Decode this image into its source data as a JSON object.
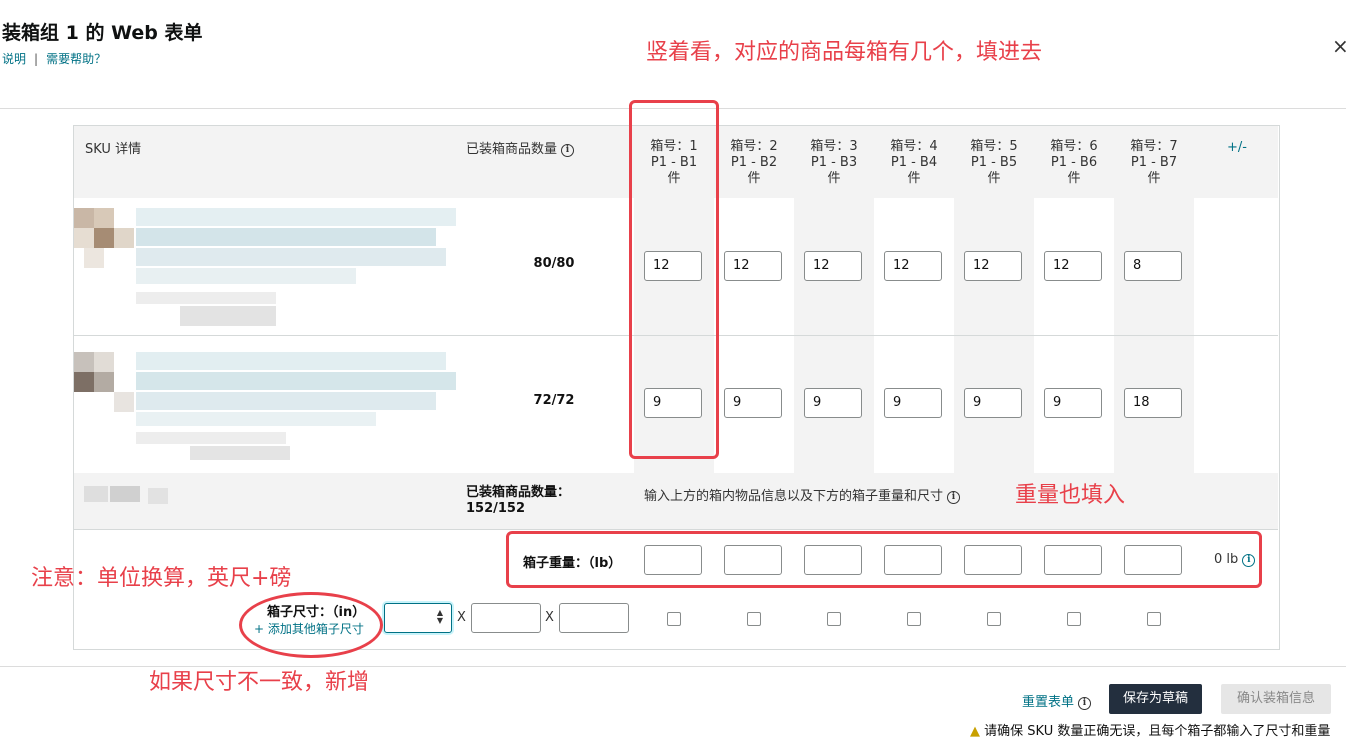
{
  "dialog": {
    "title": "装箱组 1 的 Web 表单",
    "link_instructions": "说明",
    "link_separator": "|",
    "link_help": "需要帮助？",
    "close_glyph": "×"
  },
  "table": {
    "col_sku": "SKU 详情",
    "col_packed": "已装箱商品数量",
    "add_remove": "+/-",
    "boxes": [
      {
        "line1": "箱号：1",
        "line2": "P1 - B1",
        "line3": "件"
      },
      {
        "line1": "箱号：2",
        "line2": "P1 - B2",
        "line3": "件"
      },
      {
        "line1": "箱号：3",
        "line2": "P1 - B3",
        "line3": "件"
      },
      {
        "line1": "箱号：4",
        "line2": "P1 - B4",
        "line3": "件"
      },
      {
        "line1": "箱号：5",
        "line2": "P1 - B5",
        "line3": "件"
      },
      {
        "line1": "箱号：6",
        "line2": "P1 - B6",
        "line3": "件"
      },
      {
        "line1": "箱号：7",
        "line2": "P1 - B7",
        "line3": "件"
      }
    ],
    "rows": [
      {
        "packed": "80/80",
        "values": [
          "12",
          "12",
          "12",
          "12",
          "12",
          "12",
          "8"
        ]
      },
      {
        "packed": "72/72",
        "values": [
          "9",
          "9",
          "9",
          "9",
          "9",
          "9",
          "18"
        ]
      }
    ],
    "summary_label": "已装箱商品数量：",
    "summary_value": "152/152",
    "summary_hint": "输入上方的箱内物品信息以及下方的箱子重量和尺寸",
    "weight_label": "箱子重量：（lb）",
    "weight_total": "0 lb",
    "dims_label": "箱子尺寸：（in）",
    "add_dims_link": "+ 添加其他箱子尺寸",
    "dims_x": "X"
  },
  "footer": {
    "reset": "重置表单",
    "save_draft": "保存为草稿",
    "confirm": "确认装箱信息",
    "warning": "请确保 SKU 数量正确无误，且每个箱子都输入了尺寸和重量"
  },
  "annotations": {
    "vertical_tip": "竖着看，对应的商品每箱有几个，填进去",
    "weight_tip": "重量也填入",
    "unit_tip": "注意：单位换算，英尺+磅",
    "size_tip": "如果尺寸不一致，新增"
  },
  "colors": {
    "annotation_red": "#e8404a",
    "link_teal": "#007185",
    "primary_dark": "#232f3e"
  }
}
